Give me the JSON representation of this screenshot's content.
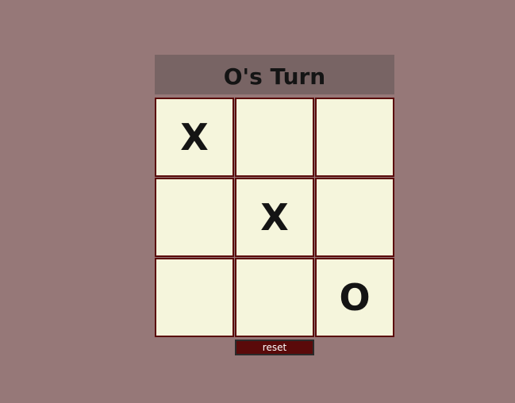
{
  "status": {
    "text": "O's Turn"
  },
  "board": {
    "cells": [
      {
        "value": "X"
      },
      {
        "value": ""
      },
      {
        "value": ""
      },
      {
        "value": ""
      },
      {
        "value": "X"
      },
      {
        "value": ""
      },
      {
        "value": ""
      },
      {
        "value": ""
      },
      {
        "value": "O"
      }
    ]
  },
  "controls": {
    "reset_label": "reset"
  },
  "colors": {
    "page_background": "#967878",
    "status_background": "#786464",
    "cell_background": "#f5f5dc",
    "cell_border": "#5a0a0a",
    "mark_color": "#141414",
    "reset_background": "#5a0a0a"
  }
}
